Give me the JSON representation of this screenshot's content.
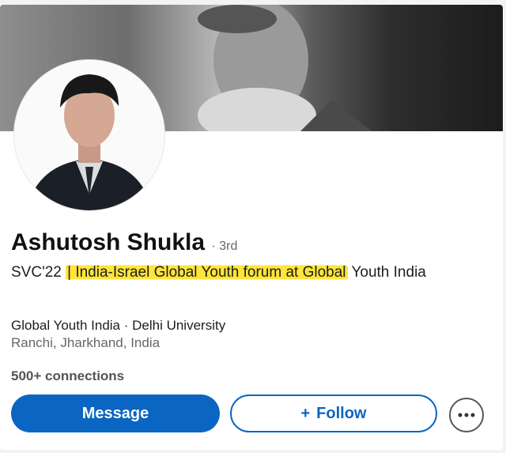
{
  "profile": {
    "name": "Ashutosh Shukla",
    "degree": "· 3rd",
    "headline_prefix": "SVC'22 ",
    "headline_highlight": "| India-Israel Global Youth forum at Global",
    "headline_suffix": " Youth India",
    "company_line": "Global Youth India · Delhi University",
    "location": "Ranchi, Jharkhand, India",
    "connections": "500+ connections"
  },
  "actions": {
    "message_label": "Message",
    "follow_icon": "+",
    "follow_label": "Follow",
    "more_icon": "more-icon"
  },
  "colors": {
    "primary": "#0a66c2",
    "highlight": "#ffe53b"
  }
}
